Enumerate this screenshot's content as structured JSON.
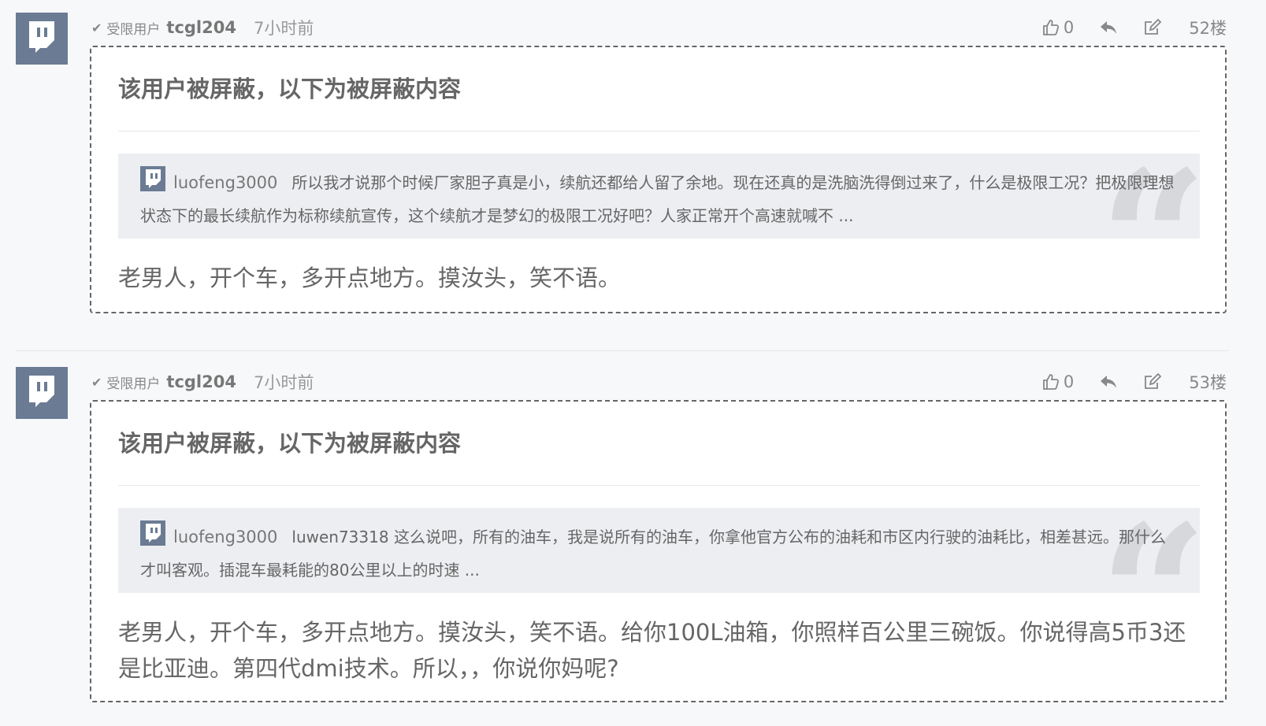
{
  "posts": [
    {
      "role": "受限用户",
      "username": "tcgl204",
      "time": "7小时前",
      "likes": "0",
      "floor": "52楼",
      "blocked_notice": "该用户被屏蔽，以下为被屏蔽内容",
      "quote_user": "luofeng3000",
      "quote_text": "所以我才说那个时候厂家胆子真是小，续航还都给人留了余地。现在还真的是洗脑洗得倒过来了，什么是极限工况？把极限理想状态下的最长续航作为标称续航宣传，这个续航才是梦幻的极限工况好吧？人家正常开个高速就喊不 ...",
      "content": "老男人，开个车，多开点地方。摸汝头，笑不语。"
    },
    {
      "role": "受限用户",
      "username": "tcgl204",
      "time": "7小时前",
      "likes": "0",
      "floor": "53楼",
      "blocked_notice": "该用户被屏蔽，以下为被屏蔽内容",
      "quote_user": "luofeng3000",
      "quote_text": "luwen73318 这么说吧，所有的油车，我是说所有的油车，你拿他官方公布的油耗和市区内行驶的油耗比，相差甚远。那什么才叫客观。插混车最耗能的80公里以上的时速 ...",
      "content": "老男人，开个车，多开点地方。摸汝头，笑不语。给你100L油箱，你照样百公里三碗饭。你说得高5币3还是比亚迪。第四代dmi技术。所以，，你说你妈呢?"
    }
  ],
  "icons": {
    "avatar": "twitch-logo-icon",
    "role_mark": "check-mark-icon",
    "like": "thumbs-up-icon",
    "reply": "reply-arrow-icon",
    "edit": "edit-icon",
    "quote": "quote-mark-icon"
  },
  "colors": {
    "avatar_bg": "#6b7b93",
    "box_border": "#666666",
    "quote_bg": "#eceef1",
    "page_bg": "#f7f8fa"
  }
}
